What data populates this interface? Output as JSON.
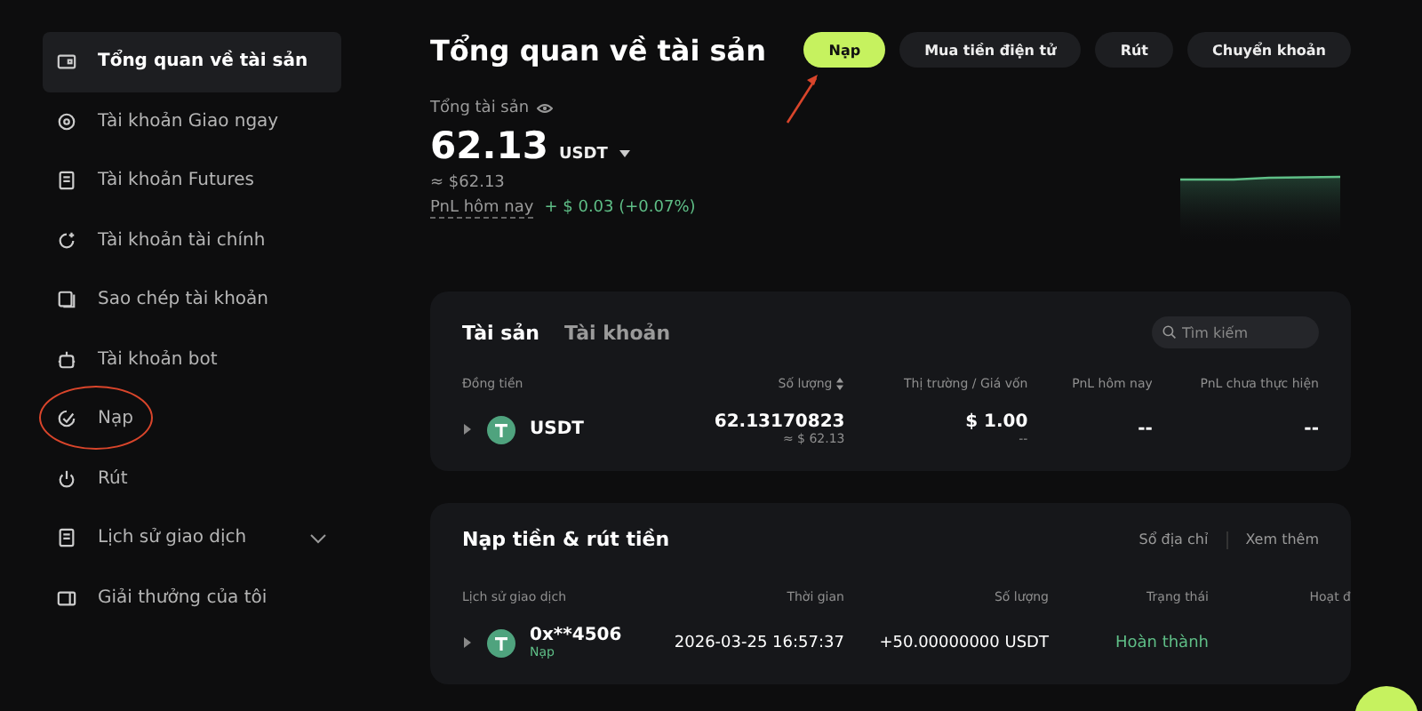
{
  "sidebar": {
    "items": [
      {
        "label": "Tổng quan về tài sản",
        "selected": true,
        "circled": false,
        "expandable": false
      },
      {
        "label": "Tài khoản Giao ngay",
        "selected": false,
        "circled": false,
        "expandable": false
      },
      {
        "label": "Tài khoản Futures",
        "selected": false,
        "circled": false,
        "expandable": false
      },
      {
        "label": "Tài khoản tài chính",
        "selected": false,
        "circled": false,
        "expandable": false
      },
      {
        "label": "Sao chép tài khoản",
        "selected": false,
        "circled": false,
        "expandable": false
      },
      {
        "label": "Tài khoản bot",
        "selected": false,
        "circled": false,
        "expandable": false
      },
      {
        "label": "Nạp",
        "selected": false,
        "circled": true,
        "expandable": false
      },
      {
        "label": "Rút",
        "selected": false,
        "circled": false,
        "expandable": false
      },
      {
        "label": "Lịch sử giao dịch",
        "selected": false,
        "circled": false,
        "expandable": true
      },
      {
        "label": "Giải thưởng của tôi",
        "selected": false,
        "circled": false,
        "expandable": false
      }
    ]
  },
  "page_title": "Tổng quan về tài sản",
  "actions": [
    {
      "label": "Nạp",
      "primary": true,
      "pointed": true
    },
    {
      "label": "Mua tiền điện tử",
      "primary": false,
      "pointed": false
    },
    {
      "label": "Rút",
      "primary": false,
      "pointed": false
    },
    {
      "label": "Chuyển khoản",
      "primary": false,
      "pointed": false
    }
  ],
  "total": {
    "label": "Tổng tài sản",
    "amount": "62.13",
    "unit": "USDT",
    "approx": "≈ $62.13",
    "pnl_label": "PnL hôm nay",
    "pnl_value": "+ $ 0.03 (+0.07%)"
  },
  "assets": {
    "tabs": [
      {
        "label": "Tài sản",
        "selected": true
      },
      {
        "label": "Tài khoản",
        "selected": false
      }
    ],
    "search": {
      "placeholder": "Tìm kiếm"
    },
    "columns": [
      "Đồng tiền",
      "Số lượng",
      "Thị trường / Giá vốn",
      "PnL hôm nay",
      "PnL chưa thực hiện"
    ],
    "rows": [
      {
        "coin": "USDT",
        "amount": "62.13170823",
        "amount_usd": "≈ $ 62.13",
        "price": "$ 1.00",
        "cost": "--",
        "pnl_today": "--",
        "pnl_unrealized": "--"
      }
    ]
  },
  "history": {
    "title": "Nạp tiền & rút tiền",
    "links": [
      "Sổ địa chỉ",
      "Xem thêm"
    ],
    "columns": [
      "Lịch sử giao dịch",
      "Thời gian",
      "Số lượng",
      "Trạng thái",
      "Hoạt đ"
    ],
    "rows": [
      {
        "address": "0x**4506",
        "type": "Nạp",
        "time": "2026-03-25 16:57:37",
        "amount": "+50.00000000 USDT",
        "status": "Hoàn thành"
      }
    ]
  }
}
